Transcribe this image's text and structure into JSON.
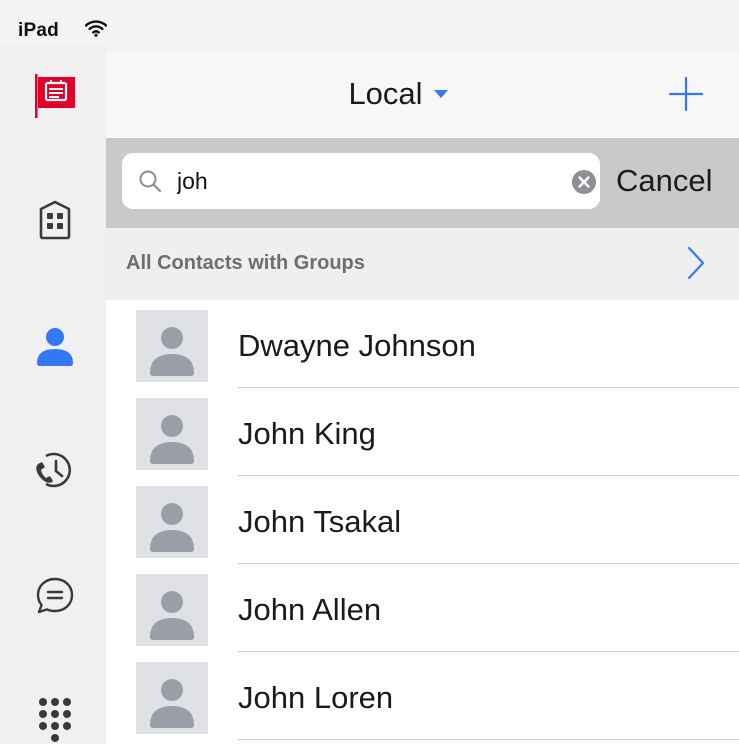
{
  "status_bar": {
    "device": "iPad",
    "wifi_icon": "wifi-icon"
  },
  "rail": {
    "items": [
      {
        "name": "logo",
        "icon": "red-flag-logo-icon"
      },
      {
        "name": "directory",
        "icon": "building-icon"
      },
      {
        "name": "contacts",
        "icon": "person-icon",
        "active": true
      },
      {
        "name": "recents",
        "icon": "phone-history-icon"
      },
      {
        "name": "messages",
        "icon": "chat-bubble-icon"
      },
      {
        "name": "keypad",
        "icon": "dialpad-icon"
      }
    ]
  },
  "nav": {
    "title": "Local",
    "dropdown_icon": "caret-down-icon",
    "add_icon": "plus-icon"
  },
  "search": {
    "value": "joh",
    "cancel_label": "Cancel",
    "search_icon": "search-icon",
    "clear_icon": "clear-icon"
  },
  "groups": {
    "label": "All Contacts with Groups",
    "chevron_icon": "chevron-right-icon"
  },
  "contacts": [
    {
      "name": "Dwayne Johnson"
    },
    {
      "name": "John King"
    },
    {
      "name": "John Tsakal"
    },
    {
      "name": "John Allen"
    },
    {
      "name": "John Loren"
    }
  ],
  "colors": {
    "accent": "#3478f6",
    "brand_red": "#e0002a",
    "active_rail": "#3478f6",
    "rail_icon": "#3a3a3c",
    "avatar_bg": "#dfe1e5",
    "avatar_fg": "#9a9ea6"
  }
}
